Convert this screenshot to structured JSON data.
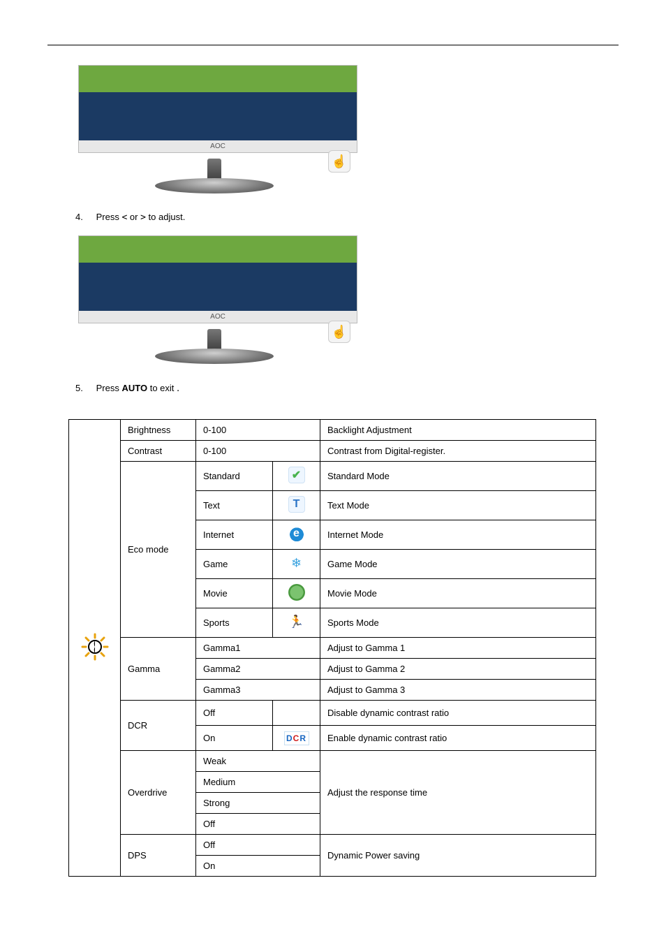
{
  "steps": {
    "s4_num": "4.",
    "s4_text_a": "Press ",
    "s4_text_b": " or ",
    "s4_text_c": "   to adjust.",
    "s4_lt": "<",
    "s4_gt": ">",
    "s5_num": "5.",
    "s5_text_a": "Press ",
    "s5_auto": "AUTO",
    "s5_text_b": " to exit",
    "s5_dot": "."
  },
  "osd": {
    "label": "AOC"
  },
  "table": {
    "rows": [
      {
        "cat": "Brightness",
        "opt": "0-100",
        "desc": "Backlight Adjustment"
      },
      {
        "cat": "Contrast",
        "opt": "0-100",
        "desc": "Contrast from Digital-register."
      }
    ],
    "eco": {
      "cat": "Eco mode",
      "modes": [
        {
          "opt": "Standard",
          "desc": "Standard Mode",
          "ic": "check"
        },
        {
          "opt": "Text",
          "desc": "Text Mode",
          "ic": "t"
        },
        {
          "opt": "Internet",
          "desc": "Internet Mode",
          "ic": "ie"
        },
        {
          "opt": "Game",
          "desc": "Game Mode",
          "ic": "game"
        },
        {
          "opt": "Movie",
          "desc": "Movie Mode",
          "ic": "mov"
        },
        {
          "opt": "Sports",
          "desc": "Sports Mode",
          "ic": "sports"
        }
      ]
    },
    "gamma": {
      "cat": "Gamma",
      "rows": [
        {
          "opt": "Gamma1",
          "desc": "Adjust to Gamma 1"
        },
        {
          "opt": "Gamma2",
          "desc": "Adjust to Gamma 2"
        },
        {
          "opt": "Gamma3",
          "desc": "Adjust to Gamma 3"
        }
      ]
    },
    "dcr": {
      "cat": "DCR",
      "rows": [
        {
          "opt": "Off",
          "desc": "Disable dynamic contrast ratio",
          "ic": ""
        },
        {
          "opt": "On",
          "desc": "Enable dynamic contrast ratio",
          "ic": "dcr"
        }
      ]
    },
    "overdrive": {
      "cat": "Overdrive",
      "desc": "Adjust the response time",
      "rows": [
        {
          "opt": "Weak"
        },
        {
          "opt": "Medium"
        },
        {
          "opt": "Strong"
        },
        {
          "opt": "Off"
        }
      ]
    },
    "dps": {
      "cat": "DPS",
      "desc": "Dynamic Power saving",
      "rows": [
        {
          "opt": "Off"
        },
        {
          "opt": "On"
        }
      ]
    }
  }
}
